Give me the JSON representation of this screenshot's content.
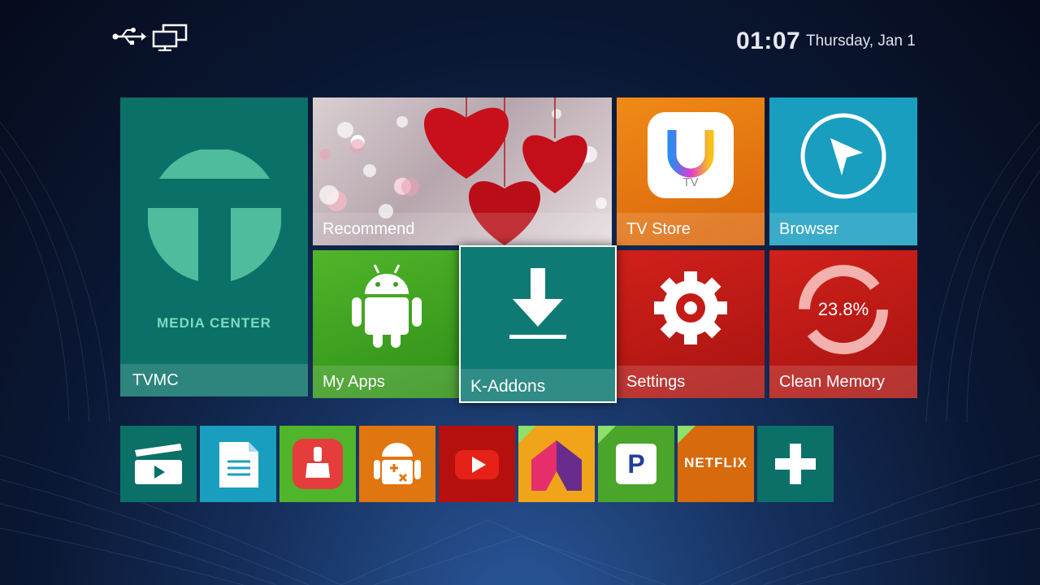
{
  "status_bar": {
    "time": "01:07",
    "date": "Thursday, Jan 1",
    "icons": [
      "usb-icon",
      "network-icon"
    ]
  },
  "tiles": {
    "tvmc": {
      "label": "TVMC",
      "logo_text": "MEDIA CENTER",
      "color": "#0b7168"
    },
    "recommend": {
      "label": "Recommend"
    },
    "tv_store": {
      "label": "TV Store",
      "app_letter": "U",
      "app_sub": "TV",
      "color": "#f08a17"
    },
    "browser": {
      "label": "Browser",
      "color": "#1a9ec0"
    },
    "my_apps": {
      "label": "My Apps",
      "color": "#50b52a"
    },
    "k_addons": {
      "label": "K-Addons",
      "color": "#0e7a73"
    },
    "settings": {
      "label": "Settings",
      "color": "#d1201b"
    },
    "clean_memory": {
      "label": "Clean Memory",
      "percent": "23.8%",
      "color": "#d1201b"
    }
  },
  "dock": [
    {
      "name": "video-player",
      "icon": "clapperboard-icon",
      "color": "#0b7168"
    },
    {
      "name": "file-manager",
      "icon": "document-icon",
      "color": "#1a9ec0"
    },
    {
      "name": "cleaner",
      "icon": "broom-icon",
      "color": "#50b52a"
    },
    {
      "name": "apk-installer",
      "icon": "android-tools-icon",
      "color": "#e0760f"
    },
    {
      "name": "youtube",
      "icon": "youtube-play-icon",
      "color": "#b5100d"
    },
    {
      "name": "mobdro",
      "icon": "house-icon",
      "color": "#f0a41a"
    },
    {
      "name": "pandora",
      "icon": "pandora-p-icon",
      "color": "#4aa52a"
    },
    {
      "name": "netflix",
      "icon": "netflix-logo-icon",
      "text": "NETFLIX",
      "color": "#d66a0c"
    },
    {
      "name": "add-app",
      "icon": "plus-icon",
      "color": "#0b7168"
    }
  ]
}
